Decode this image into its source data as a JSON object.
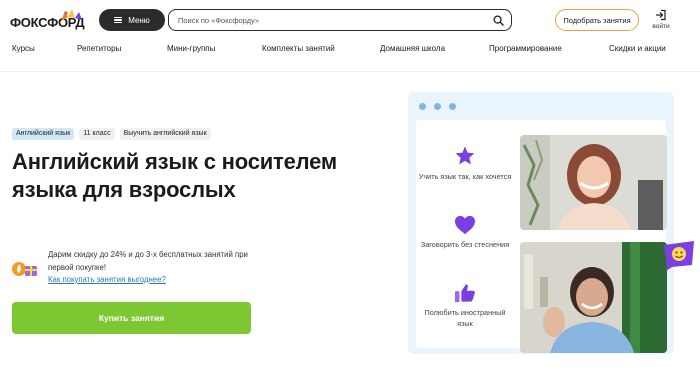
{
  "header": {
    "logo_text": "ФОКСФОРД",
    "menu_label": "Меню",
    "search_placeholder": "Поиск по «Фоксфорду»",
    "pick_label": "Подобрать занятия",
    "login_label": "войти"
  },
  "nav": [
    "Курсы",
    "Репетиторы",
    "Мини-группы",
    "Комплекты занятий",
    "Домашняя школа",
    "Программирование",
    "Скидки и акции"
  ],
  "hero": {
    "tags": [
      "Английский язык",
      "11 класс",
      "Выучить английский язык"
    ],
    "title": "Английский язык с носителем языка для взрослых",
    "promo_text": "Дарим скидку до 24% и до 3-х бесплатных занятий при первой покупке!",
    "promo_link": "Как покупать занятия выгоднее?",
    "buy_label": "Купить занятия"
  },
  "illustration": {
    "features": [
      {
        "icon": "star-icon",
        "text": "Учить язык так, как хочется"
      },
      {
        "icon": "heart-icon",
        "text": "Заговорить без стеснения"
      },
      {
        "icon": "thumbs-up-icon",
        "text": "Полюбить иностранный язык"
      }
    ]
  },
  "colors": {
    "accent_green": "#7dc832",
    "accent_purple": "#7b3fe4",
    "accent_orange": "#f0a13d",
    "link_blue": "#2a7ab8",
    "card_bg": "#eaf4fc"
  }
}
